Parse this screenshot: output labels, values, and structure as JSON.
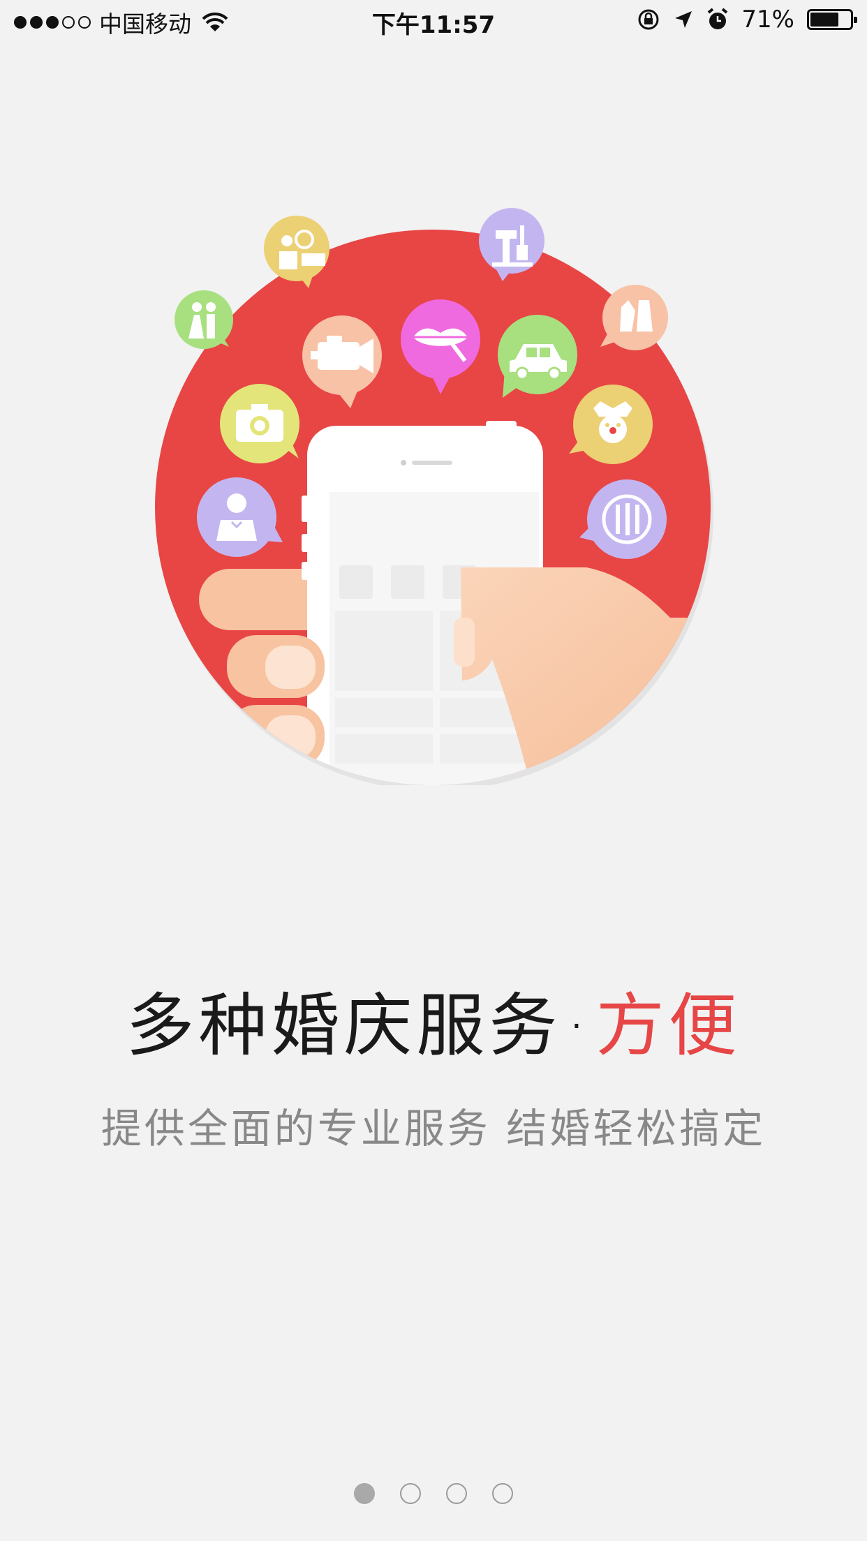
{
  "status_bar": {
    "carrier": "中国移动",
    "time": "下午11:57",
    "battery_percent": "71%",
    "battery_level": 0.71,
    "signal_bars_filled": 3,
    "signal_bars_total": 5,
    "icons": [
      "wifi-icon",
      "rotation-lock-icon",
      "location-icon",
      "alarm-icon",
      "battery-icon"
    ]
  },
  "onboarding": {
    "headline_main": "多种婚庆服务",
    "headline_separator": "·",
    "headline_accent": "方便",
    "subline": "提供全面的专业服务 结婚轻松搞定",
    "pager": {
      "total": 4,
      "active_index": 0
    }
  },
  "illustration": {
    "icons": [
      "bride-groom-icon",
      "wedding-host-icon",
      "camera-icon",
      "video-camera-icon",
      "makeup-icon",
      "car-icon",
      "cake-venue-icon",
      "tools-icon",
      "dress-icon",
      "clown-icon",
      "dining-icon"
    ]
  },
  "colors": {
    "background": "#f2f2f2",
    "circle": "#e84545",
    "accent": "#e64646",
    "bubble_purple": "#c3b6f0",
    "bubble_green": "#a8e080",
    "bubble_yellow": "#ecd074",
    "bubble_peach": "#f8c2a6",
    "bubble_pink": "#f06adf",
    "bubble_lime": "#e3e57a",
    "hand": "#f7c7a4"
  }
}
